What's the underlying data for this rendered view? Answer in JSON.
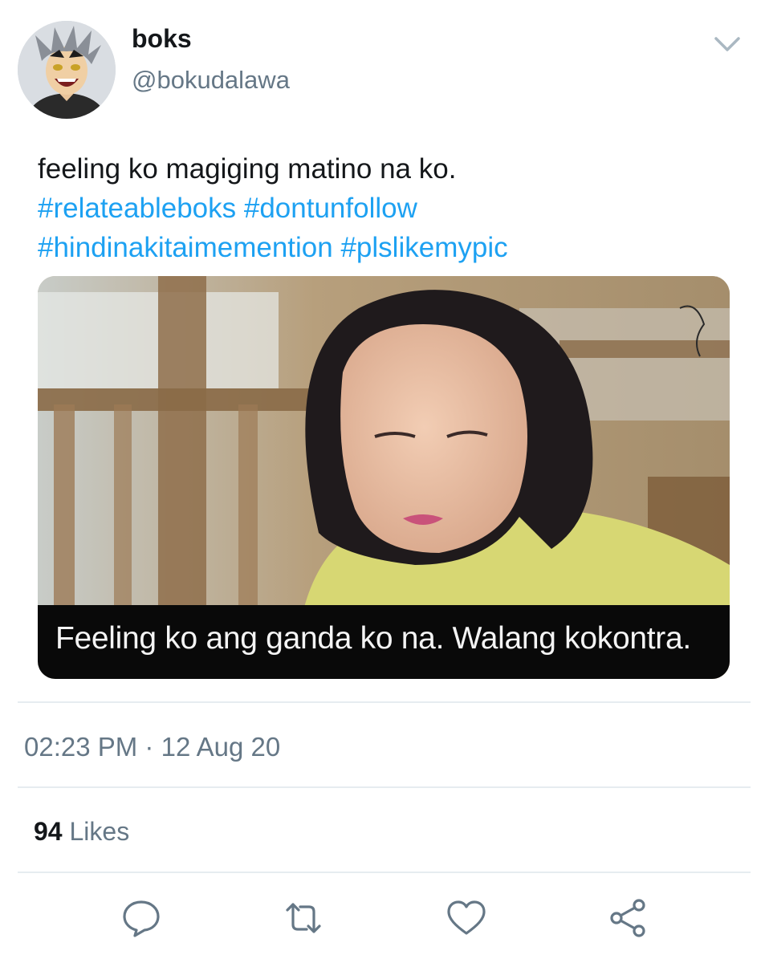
{
  "author": {
    "display_name": "boks",
    "handle": "@bokudalawa",
    "avatar_icon": "avatar-anime-character"
  },
  "tweet": {
    "text_line1": "feeling ko magiging matino na ko.",
    "hashtags": [
      "#relateableboks",
      "#dontunfollow",
      "#hindinakitaimemention",
      "#plslikemypic"
    ],
    "media_caption": "Feeling ko ang ganda ko na. Walang kokontra.",
    "time": "02:23 PM",
    "separator": "·",
    "date": "12 Aug 20"
  },
  "stats": {
    "likes_count": "94",
    "likes_label": "Likes"
  },
  "actions": [
    {
      "icon": "reply-icon"
    },
    {
      "icon": "retweet-icon"
    },
    {
      "icon": "like-icon"
    },
    {
      "icon": "share-icon"
    }
  ],
  "colors": {
    "hashtag": "#1da1f2",
    "secondary_text": "#657786",
    "primary_text": "#14171a",
    "divider": "#e6ecf0"
  }
}
